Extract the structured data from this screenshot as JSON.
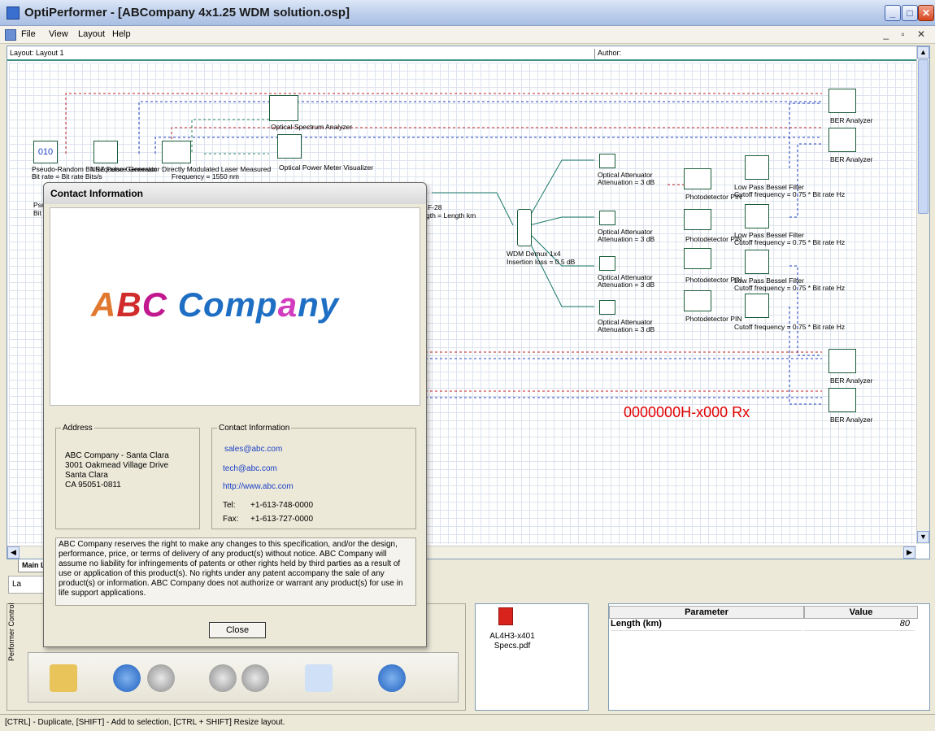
{
  "window": {
    "title": "OptiPerformer - [ABCompany 4x1.25 WDM solution.osp]"
  },
  "menu": [
    "File",
    "View",
    "Layout",
    "Help"
  ],
  "layout": {
    "layout_label": "Layout: Layout 1",
    "author_label": "Author:"
  },
  "components": {
    "prbs": "Pseudo-Random Bit Sequence Generator",
    "prbs_param": "Bit rate = Bit rate  Bits/s",
    "nrz": "NRZ Pulse Generator",
    "laser": "Directly Modulated Laser Measured",
    "laser_param": "Frequency = 1550  nm",
    "osa": "Optical Spectrum Analyzer",
    "opm": "Optical Power Meter Visualizer",
    "fiber": "F-28",
    "fiber_param": "gth = Length  km",
    "demux": "WDM Demux 1x4",
    "demux_param": "Insertion loss = 0.5  dB",
    "attenuator": "Optical Attenuator",
    "attenuator_param": "Attenuation = 3  dB",
    "photodetector": "Photodetector PIN",
    "filter": "Low Pass Bessel Filter",
    "filter_param": "Cutoff frequency = 0.75 * Bit rate  Hz",
    "ber": "BER Analyzer",
    "rx_label": "0000000H-x000 Rx",
    "prbs_short": "Pse",
    "bit_short": "Bit r"
  },
  "tabs": {
    "main_layout": "Main L",
    "project": "La"
  },
  "dialog": {
    "title": "Contact Information",
    "logo_text": "ABC Company",
    "address_legend": "Address",
    "address_lines": [
      "ABC Company - Santa Clara",
      "3001 Oakmead Village Drive",
      "Santa Clara",
      "CA 95051-0811"
    ],
    "contact_legend": "Contact Information",
    "email_sales": "sales@abc.com",
    "email_tech": "tech@abc.com",
    "website": "http://www.abc.com",
    "tel_label": "Tel:",
    "tel": "+1-613-748-0000",
    "fax_label": "Fax:",
    "fax": "+1-613-727-0000",
    "disclaimer": "ABC Company  reserves the right to make any changes to this specification, and/or the design, performance, price, or terms of delivery of any product(s) without notice. ABC Company will assume no liability for infringements of patents or other rights held by third parties as a result of use or application of this product(s). No rights under any patent accompany the sale of any product(s) or information. ABC Company does not authorize or warrant any product(s) for use in life support applications.",
    "close_label": "Close"
  },
  "performer": {
    "vertical_label": "Performer Control"
  },
  "files": {
    "pdf_name": "AL4H3-x401 Specs.pdf"
  },
  "params": {
    "header_param": "Parameter",
    "header_value": "Value",
    "rows": [
      {
        "name": "Length (km)",
        "value": "80"
      }
    ]
  },
  "status": "[CTRL] - Duplicate, [SHIFT] - Add to selection, [CTRL + SHIFT] Resize layout."
}
